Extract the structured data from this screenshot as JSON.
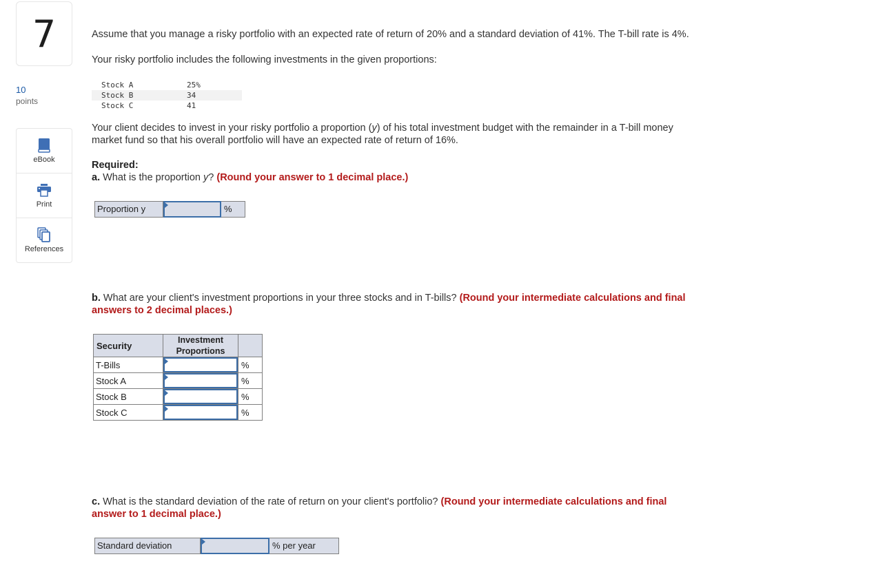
{
  "question": {
    "number": "7",
    "points_value": "10",
    "points_label": "points"
  },
  "tools": [
    {
      "label": "eBook",
      "icon": "book-icon"
    },
    {
      "label": "Print",
      "icon": "printer-icon"
    },
    {
      "label": "References",
      "icon": "copy-pages-icon"
    }
  ],
  "intro": {
    "line1": "Assume that you manage a risky portfolio with an expected rate of return of 20% and a standard deviation of 41%. The T-bill rate is 4%.",
    "line2": "Your risky portfolio includes the following investments in the given proportions:"
  },
  "holdings": [
    {
      "name": "Stock A",
      "value": "25%"
    },
    {
      "name": "Stock B",
      "value": "34"
    },
    {
      "name": "Stock C",
      "value": "41"
    }
  ],
  "client": {
    "line1_pre": "Your client decides to invest in your risky portfolio a proportion (",
    "line1_var": "y",
    "line1_post": ") of his total investment budget with the remainder in a T-bill money",
    "line2": "market fund so that his overall portfolio will have an expected rate of return of 16%."
  },
  "required_label": "Required:",
  "part_a": {
    "prefix": "a.",
    "text_pre": " What is the proportion ",
    "var": "y",
    "text_post": "? ",
    "instruction": "(Round your answer to 1 decimal place.)",
    "field_label": "Proportion y",
    "field_value": "",
    "unit": "%"
  },
  "part_b": {
    "prefix": "b.",
    "text": " What are your client's investment proportions in your three stocks and in T-bills? ",
    "instruction_line1": "(Round your intermediate calculations and final",
    "instruction_line2": "answers to 2 decimal places.)",
    "table": {
      "headers": {
        "security": "Security",
        "proportions_line1": "Investment",
        "proportions_line2": "Proportions"
      },
      "rows": [
        {
          "security": "T-Bills",
          "value": "",
          "unit": "%"
        },
        {
          "security": "Stock A",
          "value": "",
          "unit": "%"
        },
        {
          "security": "Stock B",
          "value": "",
          "unit": "%"
        },
        {
          "security": "Stock C",
          "value": "",
          "unit": "%"
        }
      ]
    }
  },
  "part_c": {
    "prefix": "c.",
    "text": " What is the standard deviation of the rate of return on your client's portfolio? ",
    "instruction_line1": "(Round your intermediate calculations and final",
    "instruction_line2": "answer to 1 decimal place.)",
    "field_label": "Standard deviation",
    "field_value": "",
    "unit": "% per year"
  },
  "colors": {
    "accent_blue": "#3c6ea8",
    "instruction_red": "#b31b1b",
    "points_blue": "#1c5aa6",
    "field_bg": "#d9dde8"
  }
}
